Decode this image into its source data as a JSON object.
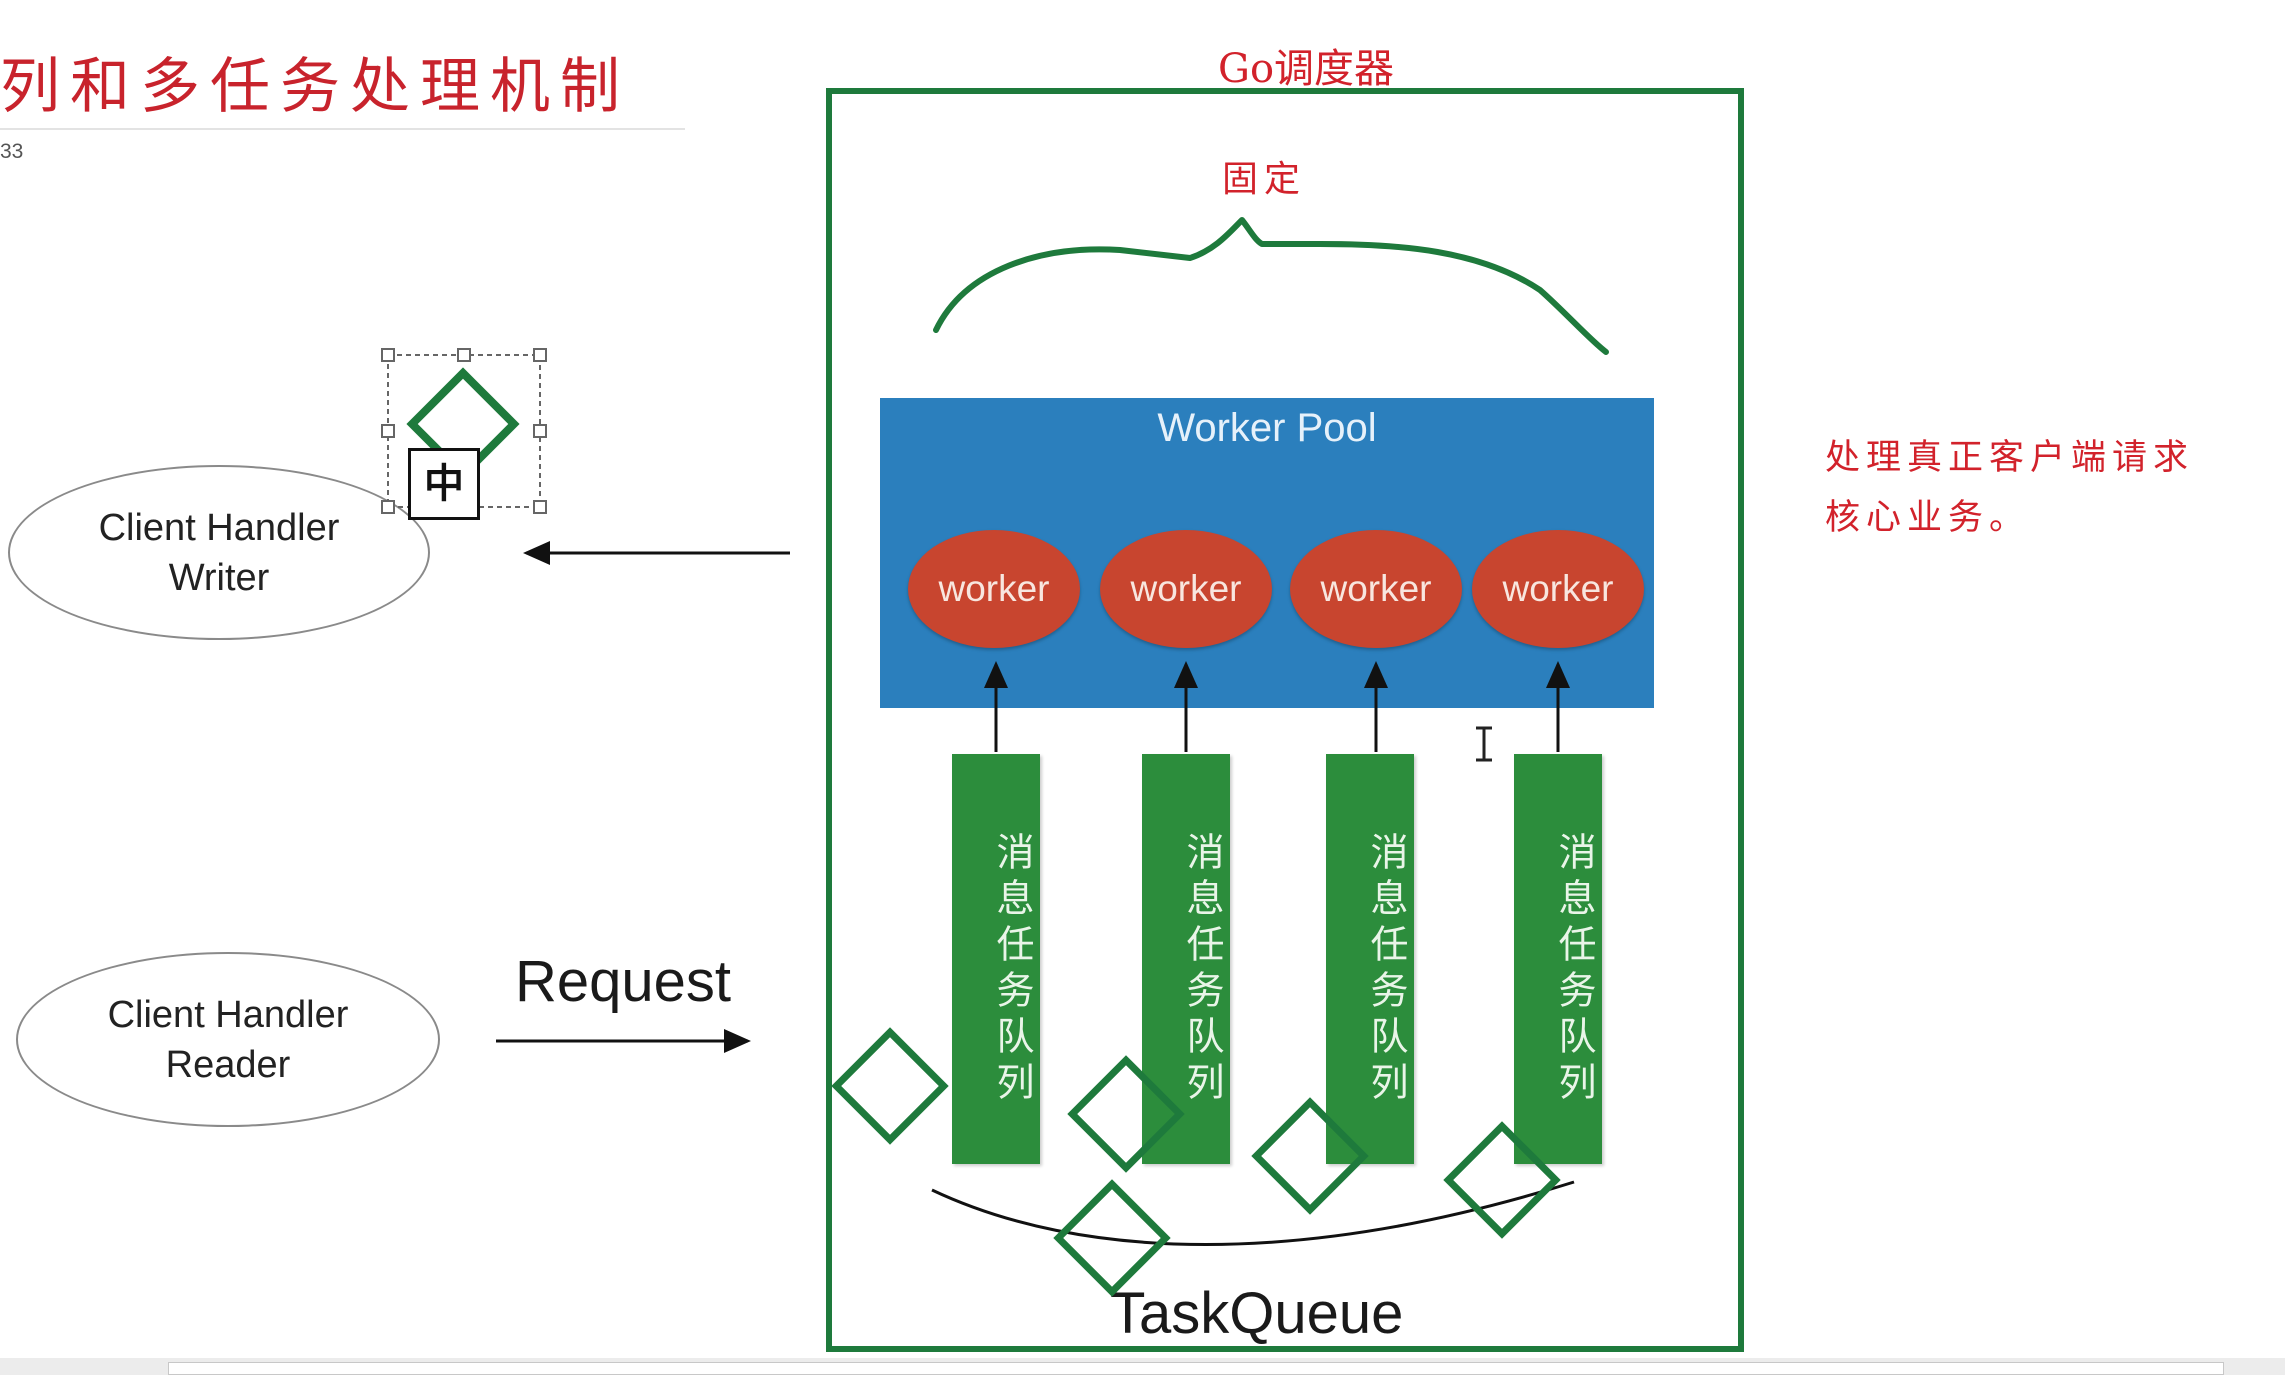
{
  "slide": {
    "title": "列和多任务处理机制",
    "page_number": "33"
  },
  "annotations": {
    "go_scheduler": "Go调度器",
    "fixed": "固定",
    "note_line1": "处理真正客户端请求",
    "note_line2": "核心业务。"
  },
  "pool": {
    "title": "Worker Pool",
    "workers": [
      "worker",
      "worker",
      "worker",
      "worker"
    ]
  },
  "queues": [
    {
      "label": "消息任务队列"
    },
    {
      "label": "消息任务队列"
    },
    {
      "label": "消息任务队列"
    },
    {
      "label": "消息任务队列"
    }
  ],
  "clients": {
    "writer_line1": "Client Handler",
    "writer_line2": "Writer",
    "reader_line1": "Client Handler",
    "reader_line2": "Reader"
  },
  "labels": {
    "request": "Request",
    "task_queue": "TaskQueue",
    "ime_indicator": "中"
  },
  "colors": {
    "annotation_red": "#d2222b",
    "frame_green": "#1e7a3c",
    "pool_blue": "#2b7fbd",
    "worker_red": "#c8452f",
    "queue_green": "#2c8d3c"
  }
}
